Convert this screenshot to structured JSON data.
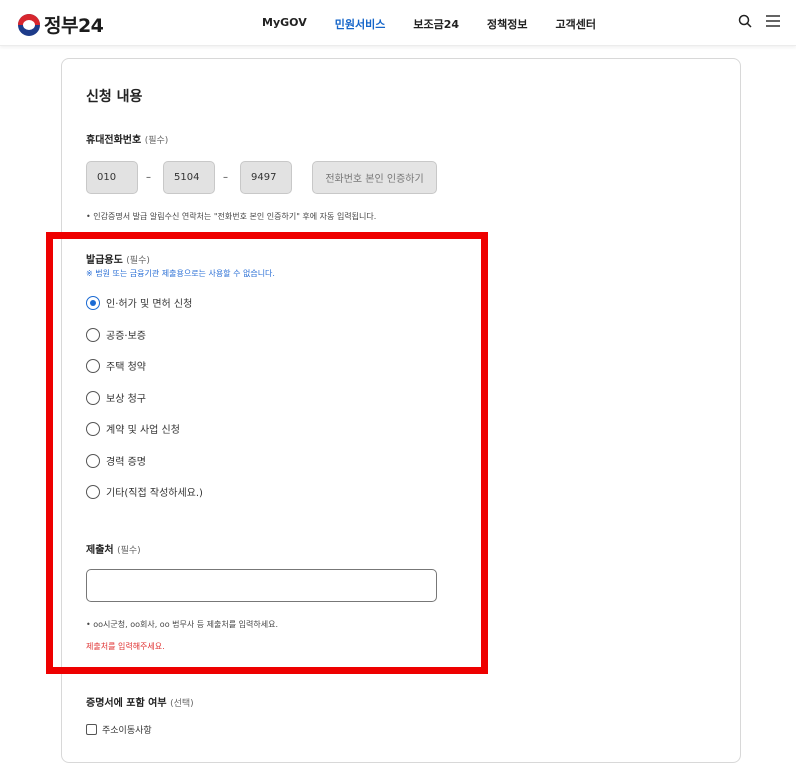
{
  "header": {
    "logo_text": "정부24",
    "nav": [
      "MyGOV",
      "민원서비스",
      "보조금24",
      "정책정보",
      "고객센터"
    ],
    "active_nav_index": 1,
    "accent_color": "#1565c9"
  },
  "form": {
    "section_title": "신청 내용",
    "phone": {
      "label": "휴대전화번호",
      "required_tag": "(필수)",
      "parts": [
        "010",
        "5104",
        "9497"
      ],
      "separator": "–",
      "verify_button": "전화번호 본인 인증하기",
      "note": "• 인감증명서 발급 알림수신 연락처는 \"전화번호 본인 인증하기\" 후에 자동 입력됩니다."
    },
    "purpose": {
      "label": "발급용도",
      "required_tag": "(필수)",
      "notice": "※ 법원 또는 금융기관 제출용으로는 사용할 수 없습니다.",
      "options": [
        "인·허가 및 면허 신청",
        "공증·보증",
        "주택 청약",
        "보상 청구",
        "계약 및 사업 신청",
        "경력 증명",
        "기타(직접 작성하세요.)"
      ],
      "selected_index": 0
    },
    "submit_to": {
      "label": "제출처",
      "required_tag": "(필수)",
      "value": "",
      "note": "• oo시군청, oo회사, oo 법무사 등 제출처를 입력하세요.",
      "error": "제출처를 입력해주세요."
    },
    "include": {
      "label": "증명서에 포함 여부",
      "optional_tag": "(선택)",
      "checkbox_label": "주소이동사항",
      "checked": false
    }
  },
  "highlight_color": "#ee0000"
}
